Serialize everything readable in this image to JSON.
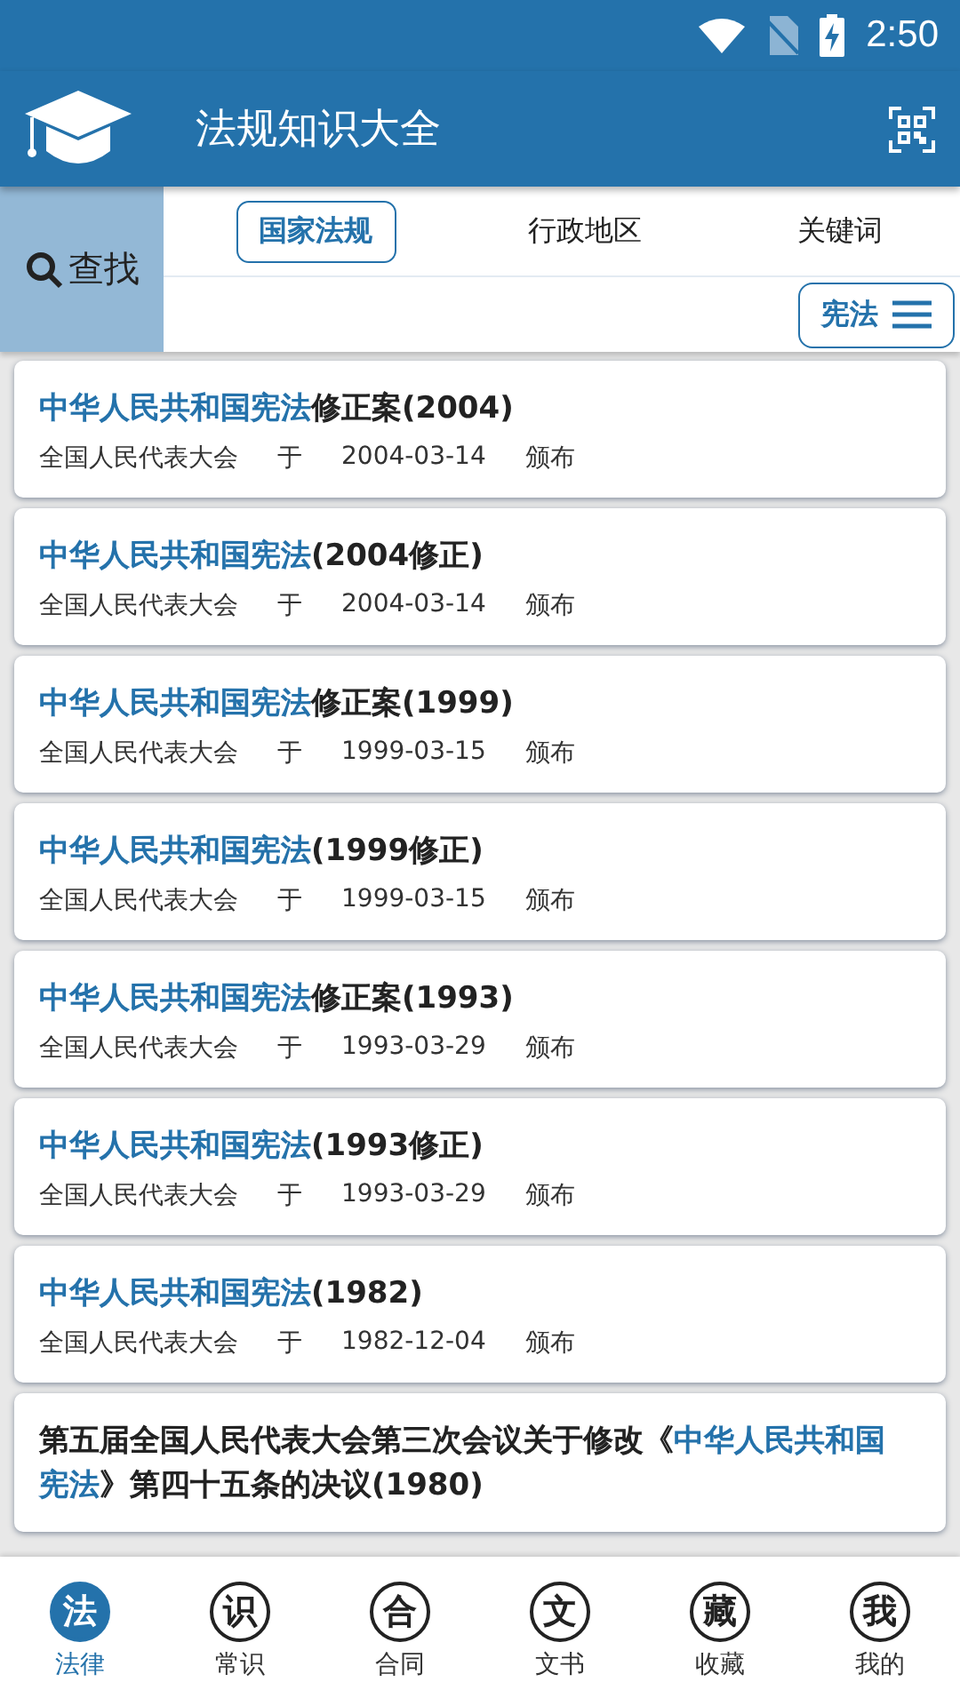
{
  "status_bar": {
    "time": "2:50"
  },
  "app_bar": {
    "title": "法规知识大全"
  },
  "search_button": {
    "label": "查找"
  },
  "tabs": [
    {
      "label": "国家法规",
      "selected": true
    },
    {
      "label": "行政地区",
      "selected": false
    },
    {
      "label": "关键词",
      "selected": false
    }
  ],
  "category_button": {
    "label": "宪法"
  },
  "laws": [
    {
      "title": [
        {
          "text": "中华人民共和国宪法",
          "highlight": true
        },
        {
          "text": "修正案(2004)",
          "highlight": false
        }
      ],
      "issuer": "全国人民代表大会",
      "at": "于",
      "date": "2004-03-14",
      "action": "颁布"
    },
    {
      "title": [
        {
          "text": "中华人民共和国宪法",
          "highlight": true
        },
        {
          "text": "(2004修正)",
          "highlight": false
        }
      ],
      "issuer": "全国人民代表大会",
      "at": "于",
      "date": "2004-03-14",
      "action": "颁布"
    },
    {
      "title": [
        {
          "text": "中华人民共和国宪法",
          "highlight": true
        },
        {
          "text": "修正案(1999)",
          "highlight": false
        }
      ],
      "issuer": "全国人民代表大会",
      "at": "于",
      "date": "1999-03-15",
      "action": "颁布"
    },
    {
      "title": [
        {
          "text": "中华人民共和国宪法",
          "highlight": true
        },
        {
          "text": "(1999修正)",
          "highlight": false
        }
      ],
      "issuer": "全国人民代表大会",
      "at": "于",
      "date": "1999-03-15",
      "action": "颁布"
    },
    {
      "title": [
        {
          "text": "中华人民共和国宪法",
          "highlight": true
        },
        {
          "text": "修正案(1993)",
          "highlight": false
        }
      ],
      "issuer": "全国人民代表大会",
      "at": "于",
      "date": "1993-03-29",
      "action": "颁布"
    },
    {
      "title": [
        {
          "text": "中华人民共和国宪法",
          "highlight": true
        },
        {
          "text": "(1993修正)",
          "highlight": false
        }
      ],
      "issuer": "全国人民代表大会",
      "at": "于",
      "date": "1993-03-29",
      "action": "颁布"
    },
    {
      "title": [
        {
          "text": "中华人民共和国宪法",
          "highlight": true
        },
        {
          "text": "(1982)",
          "highlight": false
        }
      ],
      "issuer": "全国人民代表大会",
      "at": "于",
      "date": "1982-12-04",
      "action": "颁布"
    },
    {
      "title": [
        {
          "text": "第五届全国人民代表大会第三次会议关于修改《",
          "highlight": false
        },
        {
          "text": "中华人民共和国宪法",
          "highlight": true
        },
        {
          "text": "》第四十五条的决议(1980)",
          "highlight": false
        }
      ]
    }
  ],
  "bottom_nav": [
    {
      "icon": "法",
      "label": "法律",
      "selected": true
    },
    {
      "icon": "识",
      "label": "常识",
      "selected": false
    },
    {
      "icon": "合",
      "label": "合同",
      "selected": false
    },
    {
      "icon": "文",
      "label": "文书",
      "selected": false
    },
    {
      "icon": "藏",
      "label": "收藏",
      "selected": false
    },
    {
      "icon": "我",
      "label": "我的",
      "selected": false
    }
  ]
}
